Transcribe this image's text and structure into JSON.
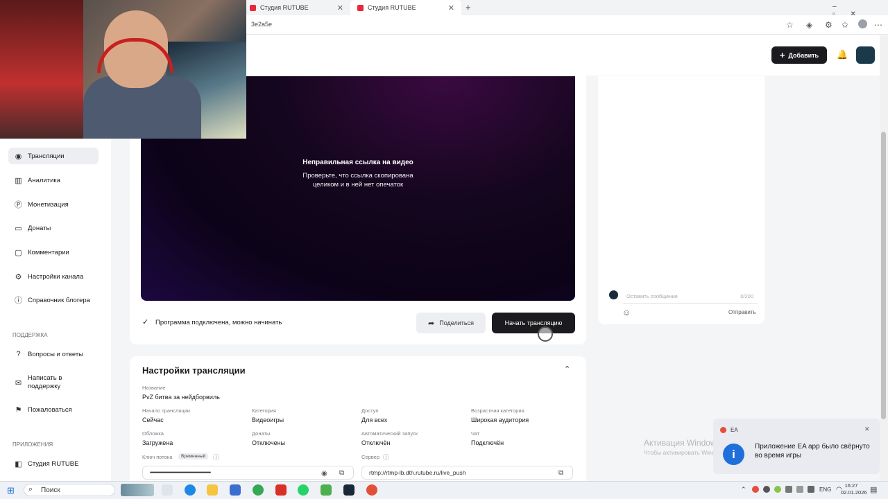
{
  "browser": {
    "tabs": [
      {
        "title": "Студия RUTUBE"
      },
      {
        "title": "Студия RUTUBE"
      }
    ],
    "url": "3e2a5e"
  },
  "header": {
    "add_button": "Добавить"
  },
  "sidebar": {
    "items": [
      {
        "label": "Трансляции",
        "icon": "broadcast-icon"
      },
      {
        "label": "Аналитика",
        "icon": "chart-icon"
      },
      {
        "label": "Монетизация",
        "icon": "coin-icon"
      },
      {
        "label": "Донаты",
        "icon": "wallet-icon"
      },
      {
        "label": "Комментарии",
        "icon": "comment-icon"
      },
      {
        "label": "Настройки канала",
        "icon": "gear-icon"
      },
      {
        "label": "Справочник блогера",
        "icon": "info-icon"
      }
    ],
    "support_heading": "ПОДДЕРЖКА",
    "support_items": [
      {
        "label": "Вопросы и ответы"
      },
      {
        "label_line1": "Написать в",
        "label_line2": "поддержку"
      },
      {
        "label": "Пожаловаться"
      }
    ],
    "apps_heading": "ПРИЛОЖЕНИЯ",
    "apps_items": [
      {
        "label": "Студия RUTUBE"
      }
    ]
  },
  "player": {
    "error_title": "Неправильная ссылка на видео",
    "error_line1": "Проверьте, что ссылка скопирована",
    "error_line2": "целиком и в ней нет опечаток"
  },
  "status": {
    "text": "Программа подключена, можно начинать",
    "share_button": "Поделиться",
    "start_button": "Начать трансляцию"
  },
  "chat": {
    "placeholder": "Оставить сообщение",
    "counter": "0/200",
    "send": "Отправить"
  },
  "settings": {
    "title": "Настройки трансляции",
    "name_label": "Название",
    "name_value": "PvZ битва за нейдборвиль",
    "fields": [
      {
        "label": "Начало трансляции",
        "value": "Сейчас"
      },
      {
        "label": "Категория",
        "value": "Видеоигры"
      },
      {
        "label": "Доступ",
        "value": "Для всех"
      },
      {
        "label": "Возрастная категория",
        "value": "Широкая аудитория"
      },
      {
        "label": "Обложка",
        "value": "Загружена"
      },
      {
        "label": "Донаты",
        "value": "Отключены"
      },
      {
        "label": "Автоматический запуск",
        "value": "Отключён"
      },
      {
        "label": "Чат",
        "value": "Подключён"
      }
    ],
    "key_label": "Ключ потока",
    "key_badge": "Временный",
    "key_value": "••••••••••••••••••••••••••••••••••••••••••••••••••••••••••••",
    "server_label": "Сервер",
    "server_value": "rtmp://rtmp-lb.dth.rutube.ru/live_push"
  },
  "notification": {
    "app": "EA",
    "text_line1": "Приложение EA app было свёрнуто",
    "text_line2": "во время игры"
  },
  "watermark": {
    "line1": "Активация Windows",
    "line2": "Чтобы активировать Windows, перейдите в раздел \"Параметры\"."
  },
  "taskbar": {
    "search": "Поиск",
    "lang": "ENG",
    "time": "16:27",
    "date": "02.01.2026"
  }
}
